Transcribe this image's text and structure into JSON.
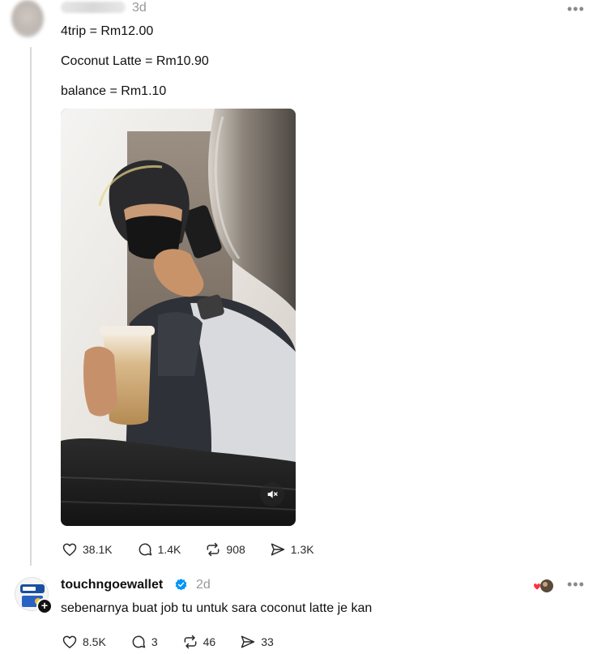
{
  "post": {
    "time": "3d",
    "lines": [
      "4trip = Rm12.00",
      "Coconut Latte = Rm10.90",
      "balance = Rm1.10"
    ],
    "more": "•••",
    "stats": {
      "likes": "38.1K",
      "comments": "1.4K",
      "reposts": "908",
      "shares": "1.3K"
    }
  },
  "reply": {
    "username": "touchngoewallet",
    "time": "2d",
    "text": "sebenarnya buat job tu untuk sara coconut latte je kan",
    "more": "•••",
    "stats": {
      "likes": "8.5K",
      "comments": "3",
      "reposts": "46",
      "shares": "33"
    }
  },
  "icons": {
    "like": "heart-icon",
    "comment": "comment-bubble-icon",
    "repost": "repost-icon",
    "share": "send-icon",
    "mute": "speaker-muted-icon",
    "verified": "verified-check-icon",
    "plus": "plus-icon"
  },
  "colors": {
    "verified_blue": "#0095f6",
    "muted_text": "#999999",
    "thread_line": "#d9d9d9"
  }
}
